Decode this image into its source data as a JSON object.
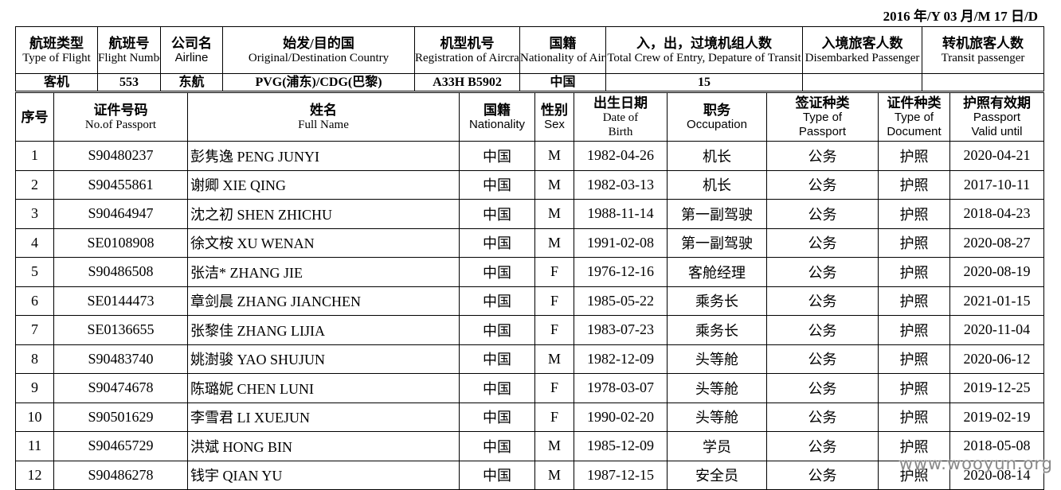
{
  "date_stamp": "2016 年/Y 03 月/M 17 日/D",
  "flight_headers": [
    {
      "zh": "航班类型",
      "en": "Type of Flight"
    },
    {
      "zh": "航班号",
      "en": "Flight Number"
    },
    {
      "zh": "公司名",
      "en": "Airline"
    },
    {
      "zh": "始发/目的国",
      "en": "Original/Destination Country"
    },
    {
      "zh": "机型机号",
      "en": "Registration of Aircraft"
    },
    {
      "zh": "国籍",
      "en": "Nationality of Aircraft"
    },
    {
      "zh": "入，出，过境机组人数",
      "en": "Total Crew of Entry, Depature of Transit"
    },
    {
      "zh": "入境旅客人数",
      "en": "Disembarked Passenger"
    },
    {
      "zh": "转机旅客人数",
      "en": "Transit passenger"
    }
  ],
  "flight_values": [
    "客机",
    "553",
    "东航",
    "PVG(浦东)/CDG(巴黎)",
    "A33H B5902",
    "中国",
    "15",
    "",
    ""
  ],
  "crew_headers": [
    {
      "zh": "序号",
      "en": ""
    },
    {
      "zh": "证件号码",
      "en": "No.of Passport"
    },
    {
      "zh": "姓名",
      "en": "Full Name"
    },
    {
      "zh": "国籍",
      "en": "Nationality"
    },
    {
      "zh": "性别",
      "en": "Sex"
    },
    {
      "zh": "出生日期",
      "en": "Date of Birth"
    },
    {
      "zh": "职务",
      "en": "Occupation"
    },
    {
      "zh": "签证种类",
      "en": "Type of Passport"
    },
    {
      "zh": "证件种类",
      "en": "Type of Document"
    },
    {
      "zh": "护照有效期",
      "en": "Passport Valid until"
    }
  ],
  "crew_rows": [
    [
      "1",
      "S90480237",
      "彭隽逸 PENG JUNYI",
      "中国",
      "M",
      "1982-04-26",
      "机长",
      "公务",
      "护照",
      "2020-04-21"
    ],
    [
      "2",
      "S90455861",
      "谢卿 XIE QING",
      "中国",
      "M",
      "1982-03-13",
      "机长",
      "公务",
      "护照",
      "2017-10-11"
    ],
    [
      "3",
      "S90464947",
      "沈之初 SHEN ZHICHU",
      "中国",
      "M",
      "1988-11-14",
      "第一副驾驶",
      "公务",
      "护照",
      "2018-04-23"
    ],
    [
      "4",
      "SE0108908",
      "徐文桉 XU WENAN",
      "中国",
      "M",
      "1991-02-08",
      "第一副驾驶",
      "公务",
      "护照",
      "2020-08-27"
    ],
    [
      "5",
      "S90486508",
      "张洁* ZHANG JIE",
      "中国",
      "F",
      "1976-12-16",
      "客舱经理",
      "公务",
      "护照",
      "2020-08-19"
    ],
    [
      "6",
      "SE0144473",
      "章剑晨 ZHANG JIANCHEN",
      "中国",
      "F",
      "1985-05-22",
      "乘务长",
      "公务",
      "护照",
      "2021-01-15"
    ],
    [
      "7",
      "SE0136655",
      "张黎佳 ZHANG LIJIA",
      "中国",
      "F",
      "1983-07-23",
      "乘务长",
      "公务",
      "护照",
      "2020-11-04"
    ],
    [
      "8",
      "S90483740",
      "姚澍骏 YAO SHUJUN",
      "中国",
      "M",
      "1982-12-09",
      "头等舱",
      "公务",
      "护照",
      "2020-06-12"
    ],
    [
      "9",
      "S90474678",
      "陈璐妮 CHEN LUNI",
      "中国",
      "F",
      "1978-03-07",
      "头等舱",
      "公务",
      "护照",
      "2019-12-25"
    ],
    [
      "10",
      "S90501629",
      "李雪君 LI XUEJUN",
      "中国",
      "F",
      "1990-02-20",
      "头等舱",
      "公务",
      "护照",
      "2019-02-19"
    ],
    [
      "11",
      "S90465729",
      "洪斌 HONG BIN",
      "中国",
      "M",
      "1985-12-09",
      "学员",
      "公务",
      "护照",
      "2018-05-08"
    ],
    [
      "12",
      "S90486278",
      "钱宇 QIAN YU",
      "中国",
      "M",
      "1987-12-15",
      "安全员",
      "公务",
      "护照",
      "2020-08-14"
    ]
  ],
  "watermark": "www.wooyun.org"
}
